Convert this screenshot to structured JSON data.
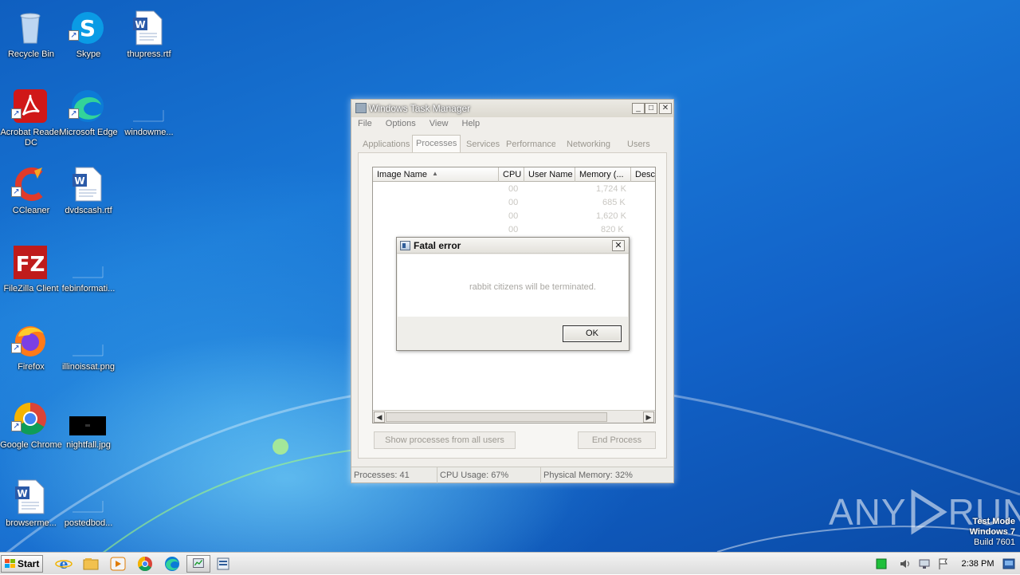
{
  "desktop": {
    "icons": [
      {
        "label": "Recycle Bin"
      },
      {
        "label": "Skype"
      },
      {
        "label": "thupress.rtf"
      },
      {
        "label": "Acrobat Reader DC"
      },
      {
        "label": "Microsoft Edge"
      },
      {
        "label": "windowme..."
      },
      {
        "label": "CCleaner"
      },
      {
        "label": "dvdscash.rtf"
      },
      {
        "label": "FileZilla Client"
      },
      {
        "label": "febinformati..."
      },
      {
        "label": "Firefox"
      },
      {
        "label": "illinoissat.png"
      },
      {
        "label": "Google Chrome"
      },
      {
        "label": "nightfall.jpg"
      },
      {
        "label": "browserme..."
      },
      {
        "label": "postedbod..."
      }
    ]
  },
  "task_manager": {
    "title": "Windows Task Manager",
    "menu": [
      "File",
      "Options",
      "View",
      "Help"
    ],
    "tabs": [
      "Applications",
      "Processes",
      "Services",
      "Performance",
      "Networking",
      "Users"
    ],
    "columns": [
      "Image Name",
      "CPU",
      "User Name",
      "Memory (...",
      "Desc"
    ],
    "rows": [
      {
        "cpu": "00",
        "mem": "1,724 K"
      },
      {
        "cpu": "00",
        "mem": "685 K"
      },
      {
        "cpu": "00",
        "mem": "1,620 K"
      },
      {
        "cpu": "00",
        "mem": "820 K"
      }
    ],
    "show_all_label": "Show processes from all users",
    "end_process_label": "End Process",
    "status": {
      "processes": "Processes: 41",
      "cpu": "CPU Usage: 67%",
      "memory": "Physical Memory: 32%"
    }
  },
  "dialog": {
    "title": "Fatal error",
    "message": "rabbit citizens will be terminated.",
    "ok_label": "OK",
    "close_glyph": "✕"
  },
  "watermark": {
    "brand_left": "ANY",
    "brand_right": "RUN",
    "mode": "Test Mode",
    "os": "Windows 7",
    "build": "Build 7601"
  },
  "taskbar": {
    "start_label": "Start",
    "clock": "2:38 PM"
  },
  "colors": {
    "desktop_blue": "#1977d6",
    "taskbar": "#e6e6e6"
  }
}
